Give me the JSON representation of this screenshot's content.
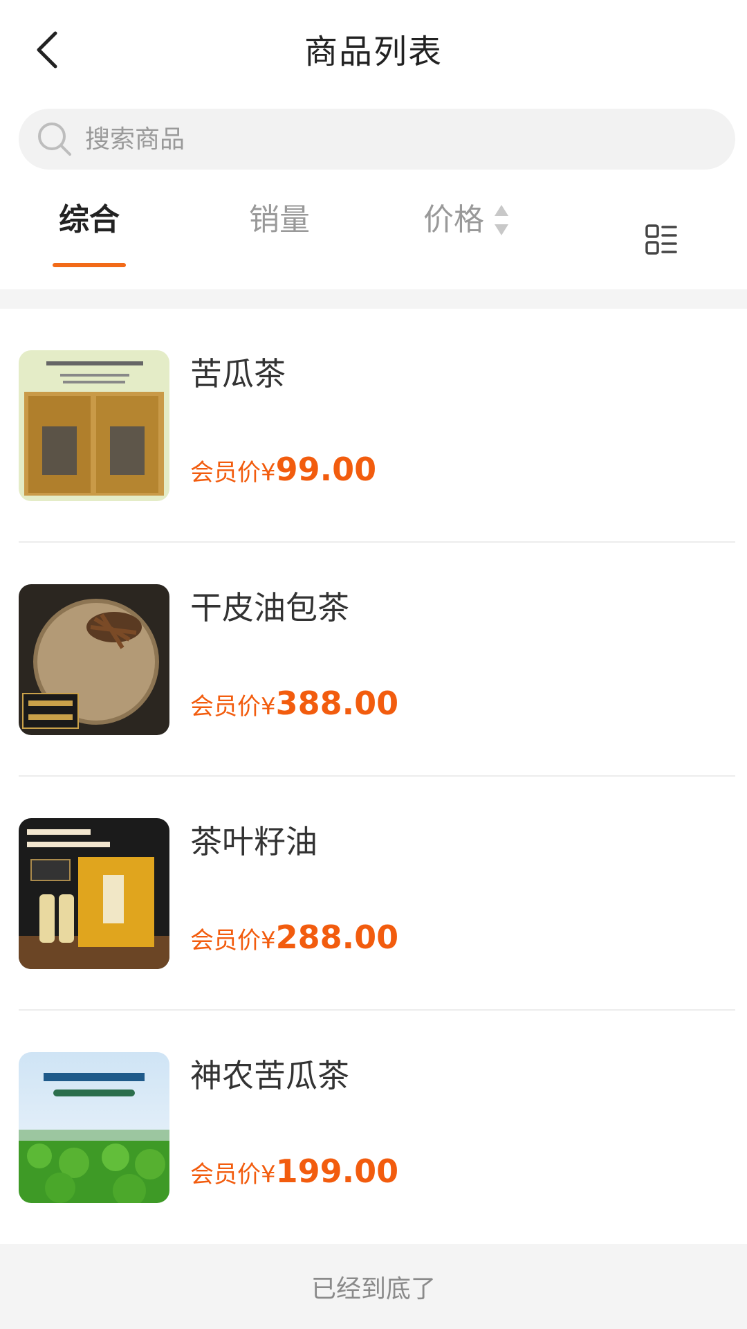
{
  "header": {
    "title": "商品列表",
    "back_icon": "chevron-left-icon"
  },
  "search": {
    "placeholder": "搜索商品",
    "value": "",
    "icon": "search-icon"
  },
  "tabs": [
    {
      "label": "综合",
      "active": true
    },
    {
      "label": "销量",
      "active": false
    },
    {
      "label": "价格",
      "active": false,
      "sort_icon": "sort-arrows-icon"
    }
  ],
  "layout_toggle_icon": "list-view-icon",
  "products": [
    {
      "name": "苦瓜茶",
      "price_label": "会员价",
      "currency": "¥",
      "price": "99.00",
      "image": "tea-bags-image"
    },
    {
      "name": "干皮油包茶",
      "price_label": "会员价",
      "currency": "¥",
      "price": "388.00",
      "image": "orange-peel-tea-image"
    },
    {
      "name": "茶叶籽油",
      "price_label": "会员价",
      "currency": "¥",
      "price": "288.00",
      "image": "tea-seed-oil-giftbox-image"
    },
    {
      "name": "神农苦瓜茶",
      "price_label": "会员价",
      "currency": "¥",
      "price": "199.00",
      "image": "tea-field-image"
    }
  ],
  "footer": {
    "text": "已经到底了"
  },
  "colors": {
    "accent": "#f26a18",
    "price": "#f25c0e",
    "search_bg": "#f2f2f2"
  }
}
